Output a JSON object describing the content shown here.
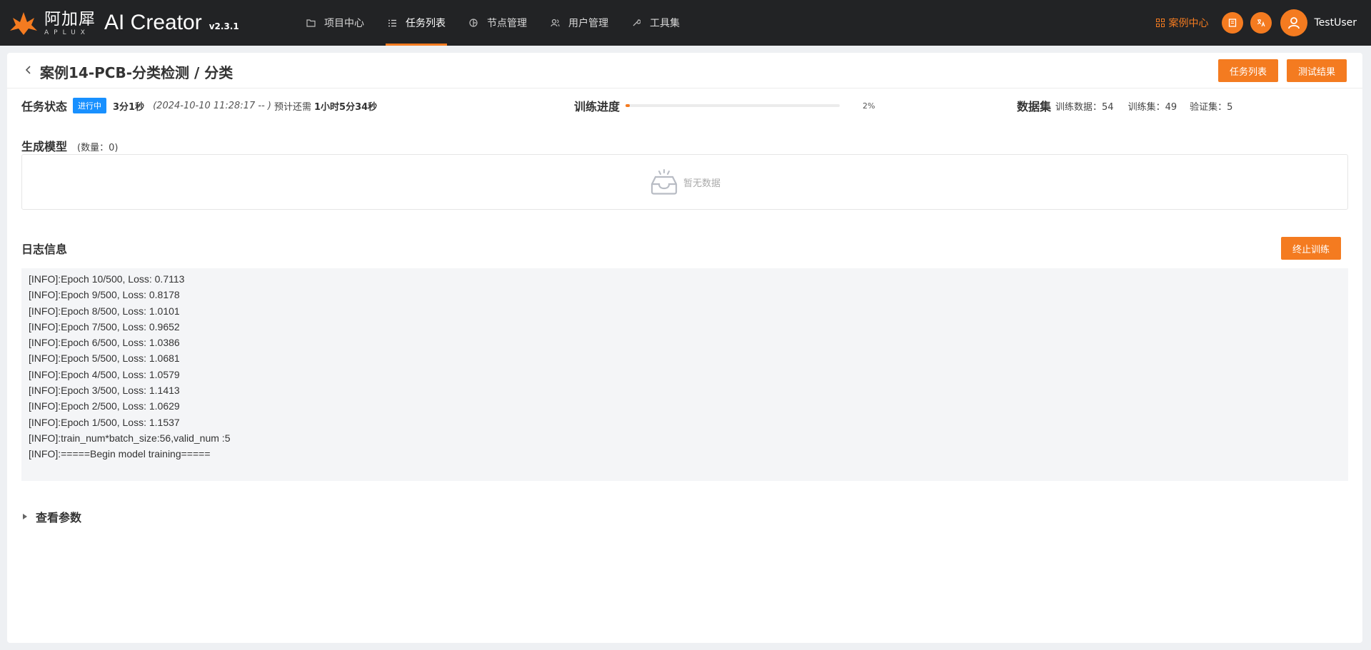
{
  "brand": {
    "cn_name": "阿加犀",
    "en_name": "APLUX",
    "product": "AI Creator",
    "version": "v2.3.1",
    "accent": "#f47b20"
  },
  "nav": {
    "items": [
      {
        "label": "项目中心",
        "icon": "folder-icon"
      },
      {
        "label": "任务列表",
        "icon": "list-icon",
        "active": true
      },
      {
        "label": "节点管理",
        "icon": "node-icon"
      },
      {
        "label": "用户管理",
        "icon": "users-icon"
      },
      {
        "label": "工具集",
        "icon": "wrench-icon"
      }
    ]
  },
  "topright": {
    "case_center": "案例中心",
    "username": "TestUser"
  },
  "page": {
    "title": "案例14-PCB-分类检测 / 分类",
    "task_list_btn": "任务列表",
    "test_result_btn": "测试结果"
  },
  "status": {
    "label": "任务状态",
    "badge": "进行中",
    "duration": "3分1秒",
    "time_range": "(2024-10-10 11:28:17 -- )",
    "eta_label": "预计还需",
    "eta_value": "1小时5分34秒"
  },
  "progress": {
    "label": "训练进度",
    "percent": 2,
    "percent_text": "2%"
  },
  "dataset": {
    "label": "数据集",
    "train_data": "训练数据：54",
    "train_set": "训练集：49",
    "valid_set": "验证集：5"
  },
  "models": {
    "label": "生成模型",
    "count": "(数量：0)",
    "empty_text": "暂无数据"
  },
  "log": {
    "title": "日志信息",
    "stop_btn": "终止训练",
    "lines": [
      "[INFO]:Epoch 10/500, Loss: 0.7113",
      "[INFO]:Epoch 9/500, Loss: 0.8178",
      "[INFO]:Epoch 8/500, Loss: 1.0101",
      "[INFO]:Epoch 7/500, Loss: 0.9652",
      "[INFO]:Epoch 6/500, Loss: 1.0386",
      "[INFO]:Epoch 5/500, Loss: 1.0681",
      "[INFO]:Epoch 4/500, Loss: 1.0579",
      "[INFO]:Epoch 3/500, Loss: 1.1413",
      "[INFO]:Epoch 2/500, Loss: 1.0629",
      "[INFO]:Epoch 1/500, Loss: 1.1537",
      "[INFO]:train_num*batch_size:56,valid_num :5",
      "[INFO]:=====Begin model training====="
    ]
  },
  "params": {
    "label": "查看参数"
  }
}
